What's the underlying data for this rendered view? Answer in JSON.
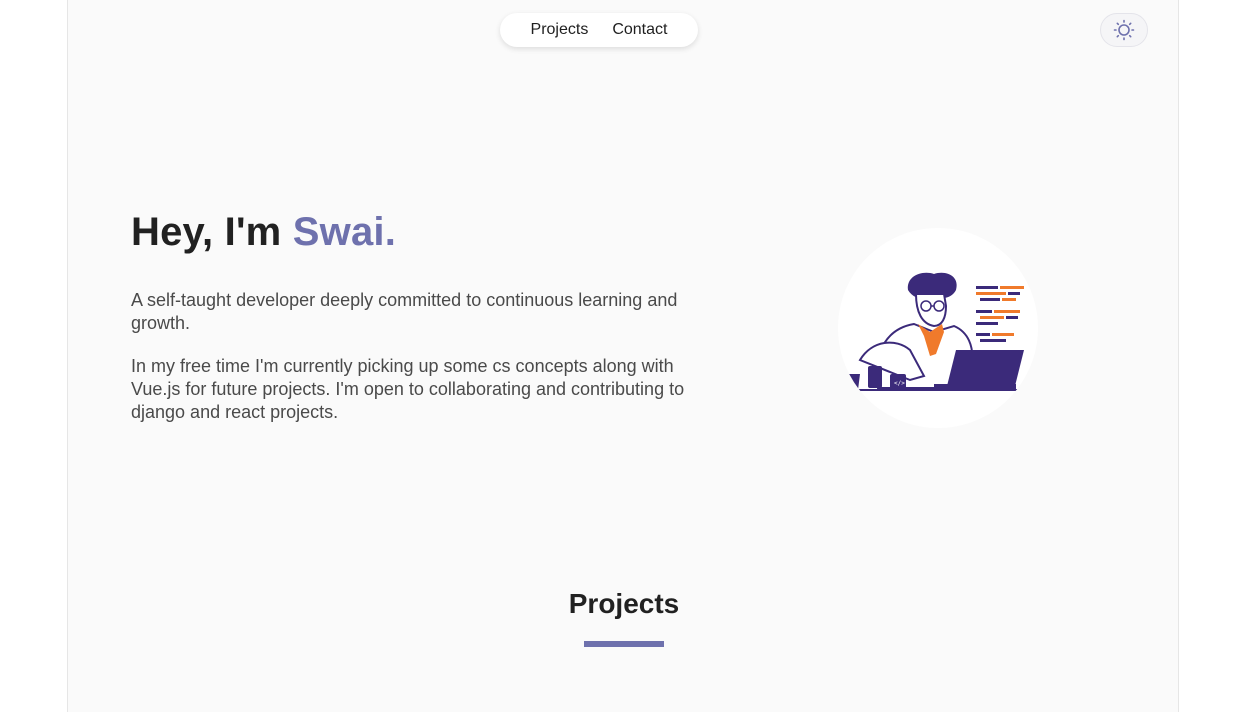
{
  "nav": {
    "links": [
      "Projects",
      "Contact"
    ]
  },
  "theme_toggle": {
    "icon": "sun-icon"
  },
  "hero": {
    "greeting": "Hey, I'm ",
    "name": "Swai.",
    "paragraph_1": "A self-taught developer deeply committed to continuous learning and growth.",
    "paragraph_2": "In my free time I'm currently picking up some cs concepts along with Vue.js for future projects. I'm open to collaborating and contributing to django and react projects."
  },
  "projects_section": {
    "title": "Projects"
  },
  "colors": {
    "accent": "#6e71ad",
    "illustration_purple": "#3b2a7a",
    "illustration_orange": "#f07a2b",
    "background": "#fafafa"
  }
}
